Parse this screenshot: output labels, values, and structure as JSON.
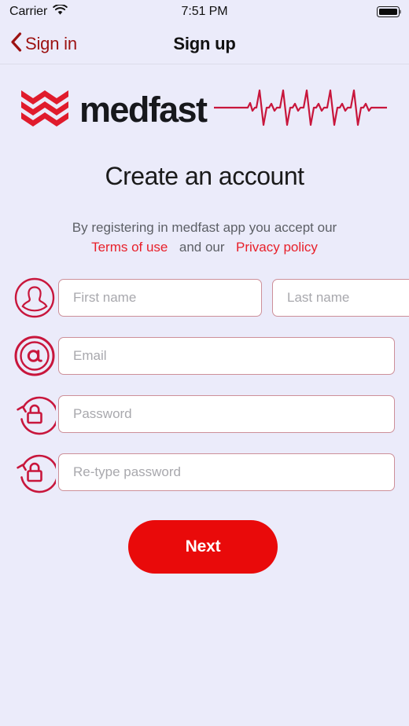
{
  "status_bar": {
    "carrier": "Carrier",
    "wifi_icon": "wifi-icon",
    "time": "7:51 PM",
    "battery_icon": "battery-full-icon"
  },
  "nav_bar": {
    "back_icon": "chevron-left-icon",
    "back_label": "Sign in",
    "title": "Sign up"
  },
  "brand": {
    "logo_mark_icon": "medfast-waves-logo-icon",
    "wordmark": "medfast",
    "ecg_icon": "heartbeat-ecg-icon"
  },
  "main": {
    "headline": "Create an account",
    "consent": {
      "lead": "By registering in medfast app you accept our",
      "terms_link": "Terms of use",
      "middle": "and our",
      "privacy_link": "Privacy policy"
    },
    "fields": [
      {
        "icon": "person-circle-icon",
        "inputs": [
          {
            "name": "first-name-input",
            "placeholder": "First name",
            "value": ""
          },
          {
            "name": "last-name-input",
            "placeholder": "Last name",
            "value": ""
          }
        ]
      },
      {
        "icon": "at-sign-circle-icon",
        "inputs": [
          {
            "name": "email-input",
            "placeholder": "Email",
            "value": ""
          }
        ]
      },
      {
        "icon": "lock-reset-icon",
        "inputs": [
          {
            "name": "password-input",
            "placeholder": "Password",
            "value": ""
          }
        ]
      },
      {
        "icon": "lock-reset-icon",
        "inputs": [
          {
            "name": "retype-password-input",
            "placeholder": "Re-type password",
            "value": ""
          }
        ]
      }
    ],
    "next_button": "Next"
  },
  "colors": {
    "background": "#ebebfa",
    "brand_crimson": "#c8163c",
    "logo_red": "#e01b2c",
    "link_red": "#e8202a",
    "button_red": "#e90a0a",
    "back_link_red": "#9c1212",
    "input_border": "#cd8f99",
    "placeholder_gray": "#a8a8ad",
    "consent_gray": "#5d6066"
  }
}
